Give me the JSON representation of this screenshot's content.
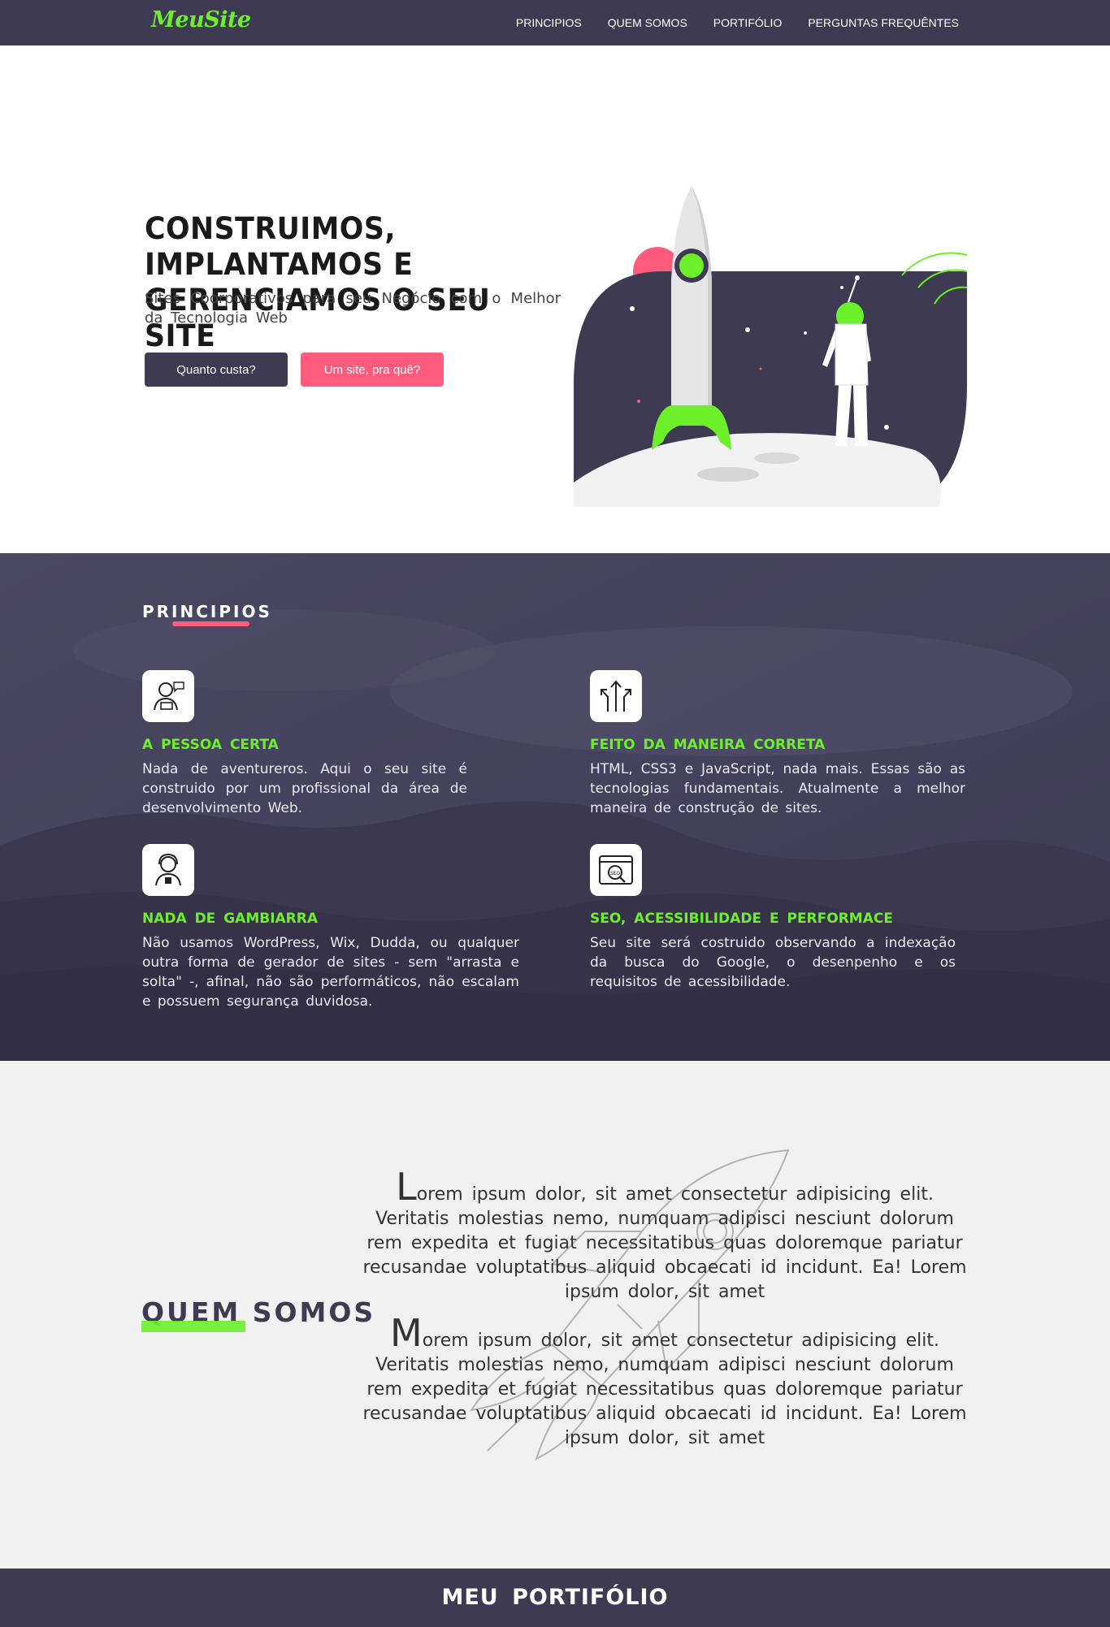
{
  "nav": {
    "logo": "MeuSite",
    "links": [
      "PRINCIPIOS",
      "QUEM SOMOS",
      "PORTIFÓLIO",
      "PERGUNTAS FREQUÊNTES"
    ]
  },
  "hero": {
    "title_line1": "CONSTRUIMOS, IMPLANTAMOS E",
    "title_line2": "GERENCIAMOS O SEU SITE",
    "subtitle": "Sites Coorporativos para seu Negócio com o Melhor da Tecnologia Web",
    "button_primary": "Quanto custa?",
    "button_secondary": "Um site, pra quê?"
  },
  "principios": {
    "title": "PRINCIPIOS",
    "cards": [
      {
        "title": "A PESSOA CERTA",
        "text": "Nada de aventureros. Aqui o seu site é construido por um profissional da área de desenvolvimento Web.",
        "icon": "developer-icon"
      },
      {
        "title": "FEITO DA MANEIRA CORRETA",
        "text": "HTML, CSS3 e JavaScript, nada mais. Essas são as tecnologias fundamentais. Atualmente a melhor maneira de construção de sites.",
        "icon": "arrows-icon"
      },
      {
        "title": "NADA DE GAMBIARRA",
        "text": "Não usamos WordPress, Wix, Dudda, ou qualquer outra forma de gerador de sites - sem \"arrasta e solta\" -, afinal, não são performáticos, não escalam e possuem segurança duvidosa.",
        "icon": "support-person-icon"
      },
      {
        "title": "SEO, ACESSIBILIDADE E PERFORMACE",
        "text": "Seu site será costruido observando a indexação da busca do Google, o desenpenho e os requisitos de acessibilidade.",
        "icon": "seo-icon"
      }
    ]
  },
  "quem": {
    "title": "QUEM SOMOS",
    "p1_cap": "L",
    "p1_rest": "orem ipsum dolor, sit amet consectetur adipisicing elit. Veritatis molestias nemo, numquam adipisci nesciunt dolorum rem expedita et fugiat necessitatibus quas doloremque pariatur recusandae voluptatibus aliquid obcaecati id incidunt. Ea! Lorem ipsum dolor, sit amet",
    "p2_cap": "M",
    "p2_rest": "orem ipsum dolor, sit amet consectetur adipisicing elit. Veritatis molestias nemo, numquam adipisci nesciunt dolorum rem expedita et fugiat necessitatibus quas doloremque pariatur recusandae voluptatibus aliquid obcaecati id incidunt. Ea! Lorem ipsum dolor, sit amet"
  },
  "portfolio": {
    "title": "MEU PORTIFÓLIO"
  },
  "colors": {
    "navy": "#3d3a52",
    "green": "#6bf02a",
    "pink": "#ff5c7d",
    "light_bg": "#f1f1f1"
  }
}
